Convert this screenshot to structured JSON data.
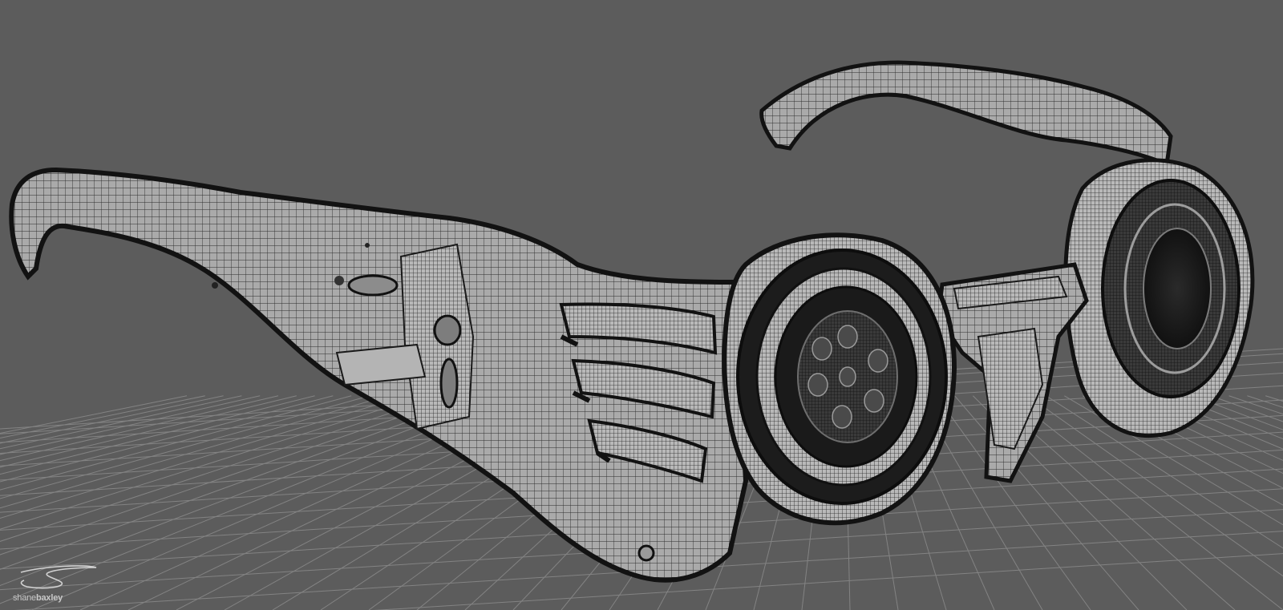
{
  "scene": {
    "description_free": true,
    "colors": {
      "background": "#5c5c5c",
      "grid_line": "#888888",
      "mesh_fill": "#a8a8a8",
      "mesh_fill_light": "#bdbdbd",
      "mesh_wire": "#2a2a2a",
      "mesh_outline": "#151515",
      "lens_dark": "#1e1e1e"
    }
  },
  "watermark": {
    "first": "shane",
    "last": "baxley",
    "icon": "signature-s-icon"
  }
}
